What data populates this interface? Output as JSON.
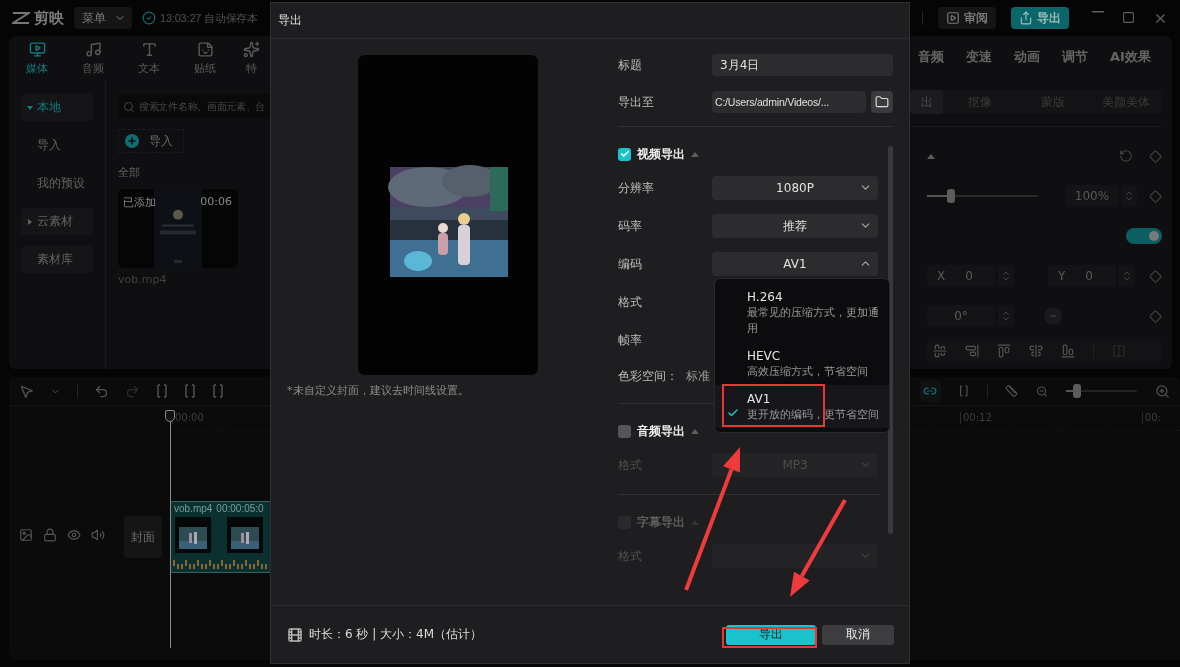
{
  "app": {
    "logo": "剪映",
    "menu": "菜单",
    "save_status": "13:03:27 自动保存本",
    "review": "审阅",
    "export": "导出"
  },
  "media_panel": {
    "tabs": [
      {
        "label": "媒体",
        "kind": "media",
        "selected": true
      },
      {
        "label": "音频",
        "kind": "audio",
        "selected": false
      },
      {
        "label": "文本",
        "kind": "text",
        "selected": false
      },
      {
        "label": "贴纸",
        "kind": "sticker",
        "selected": false
      },
      {
        "label": "特",
        "kind": "effect",
        "selected": false
      }
    ],
    "sidebar": [
      {
        "label": "本地",
        "kind": "folder",
        "expanded": true,
        "selected": true
      },
      {
        "label": "导入",
        "kind": "item",
        "selected": false
      },
      {
        "label": "我的预设",
        "kind": "item",
        "selected": false
      },
      {
        "label": "云素材",
        "kind": "folder",
        "expanded": false,
        "selected": false
      },
      {
        "label": "素材库",
        "kind": "tile",
        "selected": false
      }
    ],
    "search": {
      "placeholder": "搜索文件名称、画面元素、台"
    },
    "import_button": "导入",
    "section": "全部",
    "media": [
      {
        "badge": "已添加",
        "duration": "00:06",
        "name": "vob.mp4"
      }
    ]
  },
  "properties": {
    "tabs": [
      {
        "label": "音频",
        "selected": false
      },
      {
        "label": "变速",
        "selected": false
      },
      {
        "label": "动画",
        "selected": false
      },
      {
        "label": "调节",
        "selected": false
      },
      {
        "label": "AI效果",
        "selected": false
      }
    ],
    "subtabs": [
      {
        "label": "出",
        "selected": true
      },
      {
        "label": "抠像",
        "selected": false
      },
      {
        "label": "蒙版",
        "selected": false
      },
      {
        "label": "美颜美体",
        "selected": false
      }
    ],
    "scale": {
      "value": "100%",
      "level": 0.22
    },
    "uniform_scale": {
      "on": true
    },
    "position": [
      {
        "axis": "X",
        "value": "0"
      },
      {
        "axis": "Y",
        "value": "0"
      }
    ],
    "rotation": {
      "value": "0°"
    }
  },
  "timeline": {
    "ruler_left": "00:00",
    "ruler_right": [
      "00:12",
      "00:"
    ],
    "cover": "封面",
    "clip": {
      "name": "vob.mp4",
      "time": "00:00:05:0"
    },
    "zoom": {
      "level": 0.15
    }
  },
  "dialog": {
    "title": "导出",
    "cover_note": "*未自定义封面，建议去时间线设置。",
    "fields": [
      {
        "label": "标题",
        "value": "3月4日",
        "kind": "text"
      },
      {
        "label": "导出至",
        "value": "C:/Users/admin/Videos/...",
        "kind": "path"
      }
    ],
    "sections": [
      {
        "title": "视频导出",
        "checked": true,
        "disabled": false,
        "rows": [
          {
            "label": "分辨率",
            "kind": "select",
            "value": "1080P",
            "open": false
          },
          {
            "label": "码率",
            "kind": "select",
            "value": "推荐",
            "open": false
          },
          {
            "label": "编码",
            "kind": "select",
            "value": "AV1",
            "open": true
          },
          {
            "label": "格式",
            "kind": "covered"
          },
          {
            "label": "帧率",
            "kind": "covered"
          },
          {
            "label": "色彩空间：",
            "kind": "info",
            "value": "标准"
          }
        ]
      },
      {
        "title": "音频导出",
        "checked": false,
        "disabled": false,
        "rows": [
          {
            "label": "格式",
            "kind": "select",
            "value": "MP3",
            "open": false
          }
        ]
      },
      {
        "title": "字幕导出",
        "checked": false,
        "disabled": true,
        "rows": [
          {
            "label": "格式",
            "kind": "select",
            "open": false
          }
        ]
      }
    ],
    "codec_options": [
      {
        "name": "H.264",
        "description": "最常见的压缩方式，更加通用",
        "selected": false
      },
      {
        "name": "HEVC",
        "description": "高效压缩方式，节省空间",
        "selected": false
      },
      {
        "name": "AV1",
        "description": "更开放的编码，更节省空间",
        "selected": true
      }
    ],
    "summary": "时长：6 秒 | 大小：4M（估计）",
    "buttons": [
      {
        "label": "导出",
        "kind": "primary"
      },
      {
        "label": "取消",
        "kind": "secondary"
      }
    ]
  }
}
